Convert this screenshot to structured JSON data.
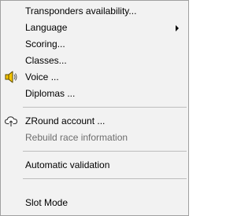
{
  "menu": {
    "items": {
      "transponders": {
        "label": "Transponders availability...",
        "enabled": true
      },
      "language": {
        "label": "Language",
        "enabled": true,
        "has_submenu": true
      },
      "scoring": {
        "label": "Scoring...",
        "enabled": true
      },
      "classes": {
        "label": "Classes...",
        "enabled": true
      },
      "voice": {
        "label": "Voice ...",
        "enabled": true,
        "icon": "speaker-icon"
      },
      "diplomas": {
        "label": "Diplomas ...",
        "enabled": true
      },
      "zround_account": {
        "label": "ZRound account ...",
        "enabled": true,
        "icon": "cloud-icon"
      },
      "rebuild_race": {
        "label": "Rebuild race information",
        "enabled": false
      },
      "automatic_validation": {
        "label": "Automatic validation",
        "enabled": true
      },
      "slot_mode": {
        "label": "Slot Mode",
        "enabled": true
      }
    }
  }
}
